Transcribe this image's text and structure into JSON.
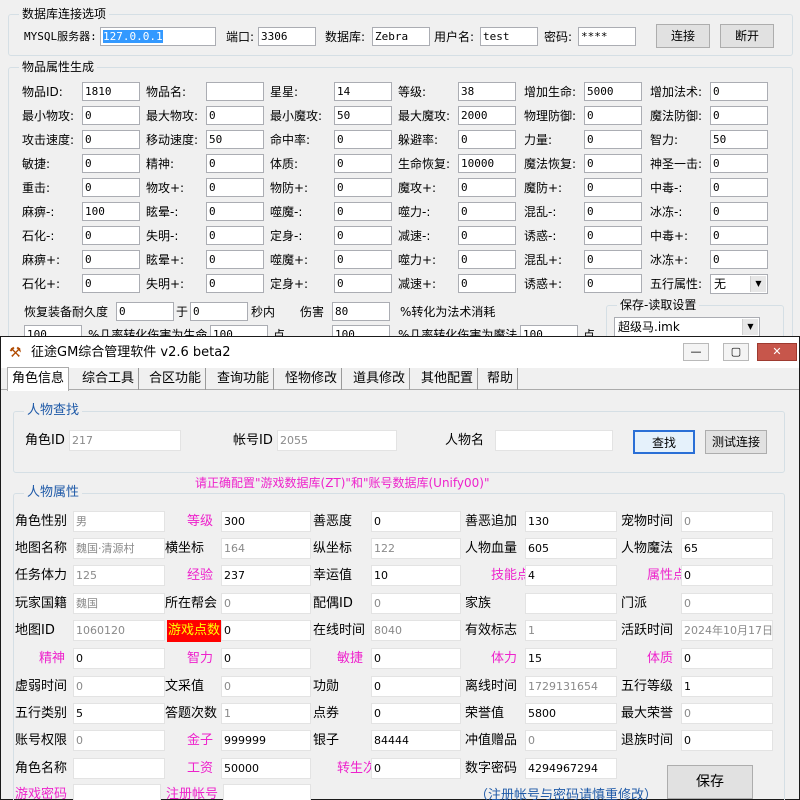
{
  "db": {
    "group_title": "数据库连接选项",
    "server_label": "MYSQL服务器:",
    "server_value": "127.0.0.1",
    "port_label": "端口:",
    "port_value": "3306",
    "dbname_label": "数据库:",
    "dbname_value": "Zebra",
    "user_label": "用户名:",
    "user_value": "test",
    "pass_label": "密码:",
    "pass_value": "****",
    "connect_label": "连接",
    "disconnect_label": "断开"
  },
  "item": {
    "group_title": "物品属性生成",
    "rows": [
      [
        [
          "物品ID:",
          "1810"
        ],
        [
          "物品名:",
          ""
        ],
        [
          "星星:",
          "14"
        ],
        [
          "等级:",
          "38"
        ],
        [
          "增加生命:",
          "5000"
        ],
        [
          "增加法术:",
          "0"
        ]
      ],
      [
        [
          "最小物攻:",
          "0"
        ],
        [
          "最大物攻:",
          "0"
        ],
        [
          "最小魔攻:",
          "50"
        ],
        [
          "最大魔攻:",
          "2000"
        ],
        [
          "物理防御:",
          "0"
        ],
        [
          "魔法防御:",
          "0"
        ]
      ],
      [
        [
          "攻击速度:",
          "0"
        ],
        [
          "移动速度:",
          "50"
        ],
        [
          "命中率:",
          "0"
        ],
        [
          "躲避率:",
          "0"
        ],
        [
          "力量:",
          "0"
        ],
        [
          "智力:",
          "50"
        ]
      ],
      [
        [
          "敏捷:",
          "0"
        ],
        [
          "精神:",
          "0"
        ],
        [
          "体质:",
          "0"
        ],
        [
          "生命恢复:",
          "10000"
        ],
        [
          "魔法恢复:",
          "0"
        ],
        [
          "神圣一击:",
          "0"
        ]
      ],
      [
        [
          "重击:",
          "0"
        ],
        [
          "物攻+:",
          "0"
        ],
        [
          "物防+:",
          "0"
        ],
        [
          "魔攻+:",
          "0"
        ],
        [
          "魔防+:",
          "0"
        ],
        [
          "中毒-:",
          "0"
        ]
      ],
      [
        [
          "麻痹-:",
          "100"
        ],
        [
          "眩晕-:",
          "0"
        ],
        [
          "噬魔-:",
          "0"
        ],
        [
          "噬力-:",
          "0"
        ],
        [
          "混乱-:",
          "0"
        ],
        [
          "冰冻-:",
          "0"
        ]
      ],
      [
        [
          "石化-:",
          "0"
        ],
        [
          "失明-:",
          "0"
        ],
        [
          "定身-:",
          "0"
        ],
        [
          "减速-:",
          "0"
        ],
        [
          "诱惑-:",
          "0"
        ],
        [
          "中毒+:",
          "0"
        ]
      ],
      [
        [
          "麻痹+:",
          "0"
        ],
        [
          "眩晕+:",
          "0"
        ],
        [
          "噬魔+:",
          "0"
        ],
        [
          "噬力+:",
          "0"
        ],
        [
          "混乱+:",
          "0"
        ],
        [
          "冰冻+:",
          "0"
        ]
      ],
      [
        [
          "石化+:",
          "0"
        ],
        [
          "失明+:",
          "0"
        ],
        [
          "定身+:",
          "0"
        ],
        [
          "减速+:",
          "0"
        ],
        [
          "诱惑+:",
          "0"
        ],
        [
          "五行属性:",
          "无"
        ]
      ]
    ],
    "repair_label": "恢复装备耐久度",
    "repair_value": "0",
    "in_label": "于",
    "in_value": "0",
    "seconds_label": "秒内",
    "damage_label": "伤害",
    "damage_value": "80",
    "convert_label": "%转化为法术消耗",
    "cut_row": [
      "100",
      "%几率转化伤害为生命",
      "100",
      "点",
      "100",
      "%几率转化伤害为魔法",
      "100",
      "点"
    ]
  },
  "save_read": {
    "group_title": "保存-读取设置",
    "selected": "超级马.imk"
  },
  "app": {
    "title": "征途GM综合管理软件 v2.6 beta2",
    "min": "—",
    "max": "▢",
    "close": "✕",
    "tabs": [
      "角色信息",
      "综合工具",
      "合区功能",
      "查询功能",
      "怪物修改",
      "道具修改",
      "其他配置",
      "帮助"
    ]
  },
  "search": {
    "group_title": "人物查找",
    "role_id_label": "角色ID",
    "role_id_value": "217",
    "account_id_label": "帐号ID",
    "account_id_value": "2055",
    "name_label": "人物名",
    "name_value": "",
    "find_label": "查找",
    "test_label": "测试连接"
  },
  "attr": {
    "group_title": "人物属性",
    "warning": "请正确配置\"游戏数据库(ZT)\"和\"账号数据库(Unify00)\"",
    "rows": [
      [
        [
          "角色性别",
          "男",
          false,
          true
        ],
        [
          "等级",
          "300",
          true,
          false
        ],
        [
          "善恶度",
          "0",
          false,
          false
        ],
        [
          "善恶追加",
          "130",
          false,
          false
        ],
        [
          "宠物时间",
          "0",
          false,
          true
        ]
      ],
      [
        [
          "地图名称",
          "魏国·清源村",
          false,
          true
        ],
        [
          "横坐标",
          "164",
          false,
          true
        ],
        [
          "纵坐标",
          "122",
          false,
          true
        ],
        [
          "人物血量",
          "605",
          false,
          false
        ],
        [
          "人物魔法",
          "65",
          false,
          false
        ]
      ],
      [
        [
          "任务体力",
          "125",
          false,
          true
        ],
        [
          "经验",
          "237",
          true,
          false
        ],
        [
          "幸运值",
          "10",
          false,
          false
        ],
        [
          "技能点",
          "4",
          true,
          false
        ],
        [
          "属性点",
          "0",
          true,
          false
        ]
      ],
      [
        [
          "玩家国籍",
          "魏国",
          false,
          true
        ],
        [
          "所在帮会",
          "0",
          false,
          true
        ],
        [
          "配偶ID",
          "0",
          false,
          true
        ],
        [
          "家族",
          "",
          false,
          true
        ],
        [
          "门派",
          "0",
          false,
          true
        ]
      ],
      [
        [
          "地图ID",
          "1060120",
          false,
          true
        ],
        [
          "游戏点数",
          "0",
          false,
          false
        ],
        [
          "在线时间",
          "8040",
          false,
          true
        ],
        [
          "有效标志",
          "1",
          false,
          true
        ],
        [
          "活跃时间",
          "2024年10月17日",
          false,
          true
        ]
      ],
      [
        [
          "精神",
          "0",
          true,
          false
        ],
        [
          "智力",
          "0",
          true,
          false
        ],
        [
          "敏捷",
          "0",
          true,
          false
        ],
        [
          "体力",
          "15",
          true,
          false
        ],
        [
          "体质",
          "0",
          true,
          false
        ]
      ],
      [
        [
          "虚弱时间",
          "0",
          false,
          true
        ],
        [
          "文采值",
          "0",
          false,
          true
        ],
        [
          "功勋",
          "0",
          false,
          false
        ],
        [
          "离线时间",
          "1729131654",
          false,
          true
        ],
        [
          "五行等级",
          "1",
          false,
          false
        ]
      ],
      [
        [
          "五行类别",
          "5",
          false,
          false
        ],
        [
          "答题次数",
          "1",
          false,
          true
        ],
        [
          "点券",
          "0",
          false,
          false
        ],
        [
          "荣誉值",
          "5800",
          false,
          false
        ],
        [
          "最大荣誉",
          "0",
          false,
          true
        ]
      ],
      [
        [
          "账号权限",
          "0",
          false,
          true
        ],
        [
          "金子",
          "999999",
          true,
          false
        ],
        [
          "银子",
          "84444",
          false,
          false
        ],
        [
          "冲值赠品",
          "0",
          false,
          true
        ],
        [
          "退族时间",
          "0",
          false,
          false
        ]
      ],
      [
        [
          "角色名称",
          "",
          false,
          false
        ],
        [
          "工资",
          "50000",
          true,
          false
        ],
        [
          "转生次数",
          "0",
          true,
          false
        ],
        [
          "数字密码",
          "4294967294",
          false,
          false
        ]
      ]
    ],
    "bottom_labels": [
      "游戏密码",
      "注册帐号"
    ],
    "save_label": "保存",
    "note": "（注册帐号与密码请慎重修改）"
  }
}
